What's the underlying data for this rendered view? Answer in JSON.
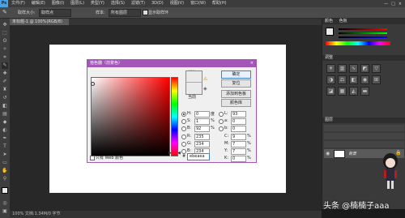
{
  "menubar": {
    "logo": "Ps",
    "items": [
      "文件(F)",
      "编辑(E)",
      "图像(I)",
      "图层(L)",
      "类型(Y)",
      "选择(S)",
      "滤镜(T)",
      "3D(D)",
      "视图(V)",
      "窗口(W)",
      "帮助(H)"
    ],
    "window_buttons": [
      "—",
      "□",
      "×"
    ]
  },
  "optbar": {
    "mode_label": "取样大小:",
    "mode_value": "取样点",
    "sample_label": "样本:",
    "sample_value": "所有图层",
    "ring_label": "显示取样环"
  },
  "doc": {
    "tab": "未标题-1 @ 100%(RGB/8)",
    "status": "100%    文档:1.34M/0 字节"
  },
  "dialog": {
    "title": "拾色器（前景色）",
    "new_label": "新的",
    "current_label": "当前",
    "buttons": {
      "ok": "确定",
      "reset": "复位",
      "add_swatch": "添加到色板",
      "libraries": "颜色库"
    },
    "fields": [
      {
        "label": "H:",
        "value": "0",
        "unit": "度"
      },
      {
        "label": "S:",
        "value": "1",
        "unit": "%"
      },
      {
        "label": "B:",
        "value": "92",
        "unit": "%"
      },
      {
        "label": "R:",
        "value": "235",
        "unit": ""
      },
      {
        "label": "G:",
        "value": "234",
        "unit": ""
      },
      {
        "label": "B:",
        "value": "234",
        "unit": ""
      }
    ],
    "lab_fields": [
      {
        "label": "L:",
        "value": "93",
        "unit": ""
      },
      {
        "label": "a:",
        "value": "0",
        "unit": ""
      },
      {
        "label": "b:",
        "value": "0",
        "unit": ""
      },
      {
        "label": "C:",
        "value": "9",
        "unit": "%"
      },
      {
        "label": "M:",
        "value": "7",
        "unit": "%"
      },
      {
        "label": "Y:",
        "value": "7",
        "unit": "%"
      },
      {
        "label": "K:",
        "value": "0",
        "unit": "%"
      }
    ],
    "hex_label": "#",
    "hex_value": "ebeaea",
    "web_only_label": "只有 Web 颜色"
  },
  "right": {
    "color_panel_tab": "颜色",
    "swatch_tab": "色板",
    "adjust_tab": "调整",
    "layers_tab": "图层",
    "layer_name": "背景"
  },
  "watermark": "头条 @楠楠子aaa",
  "colors": {
    "accent": "#a355b8",
    "current_color": "#ebeaea"
  }
}
